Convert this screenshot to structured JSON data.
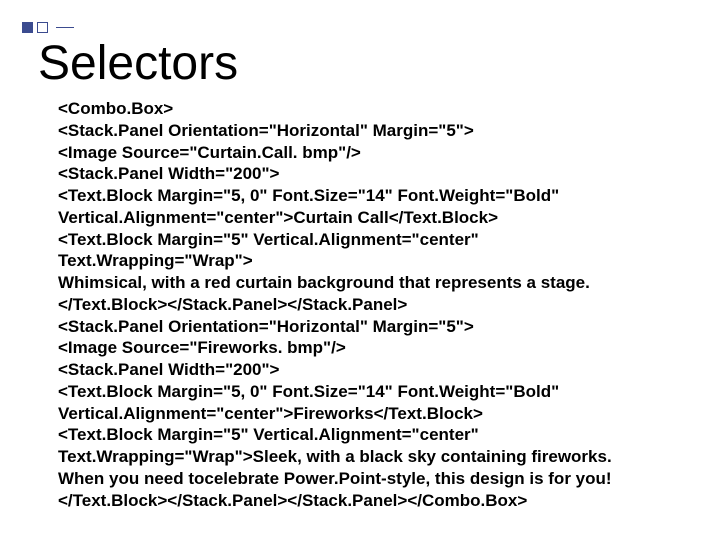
{
  "title": "Selectors",
  "lines": [
    "<Combo.Box>",
    "<Stack.Panel Orientation=\"Horizontal\" Margin=\"5\">",
    "<Image Source=\"Curtain.Call. bmp\"/>",
    "<Stack.Panel Width=\"200\">",
    "<Text.Block Margin=\"5, 0\" Font.Size=\"14\" Font.Weight=\"Bold\" Vertical.Alignment=\"center\">Curtain Call</Text.Block>",
    "<Text.Block Margin=\"5\" Vertical.Alignment=\"center\" Text.Wrapping=\"Wrap\">",
    "Whimsical, with a red curtain background that represents a stage.",
    "</Text.Block></Stack.Panel></Stack.Panel>",
    "<Stack.Panel Orientation=\"Horizontal\" Margin=\"5\">",
    "<Image Source=\"Fireworks. bmp\"/>",
    "<Stack.Panel Width=\"200\">",
    "<Text.Block Margin=\"5, 0\" Font.Size=\"14\" Font.Weight=\"Bold\" Vertical.Alignment=\"center\">Fireworks</Text.Block>",
    "<Text.Block Margin=\"5\" Vertical.Alignment=\"center\" Text.Wrapping=\"Wrap\">Sleek, with a black sky containing fireworks. When you need tocelebrate Power.Point-style, this design is for you!",
    "</Text.Block></Stack.Panel></Stack.Panel></Combo.Box>"
  ]
}
